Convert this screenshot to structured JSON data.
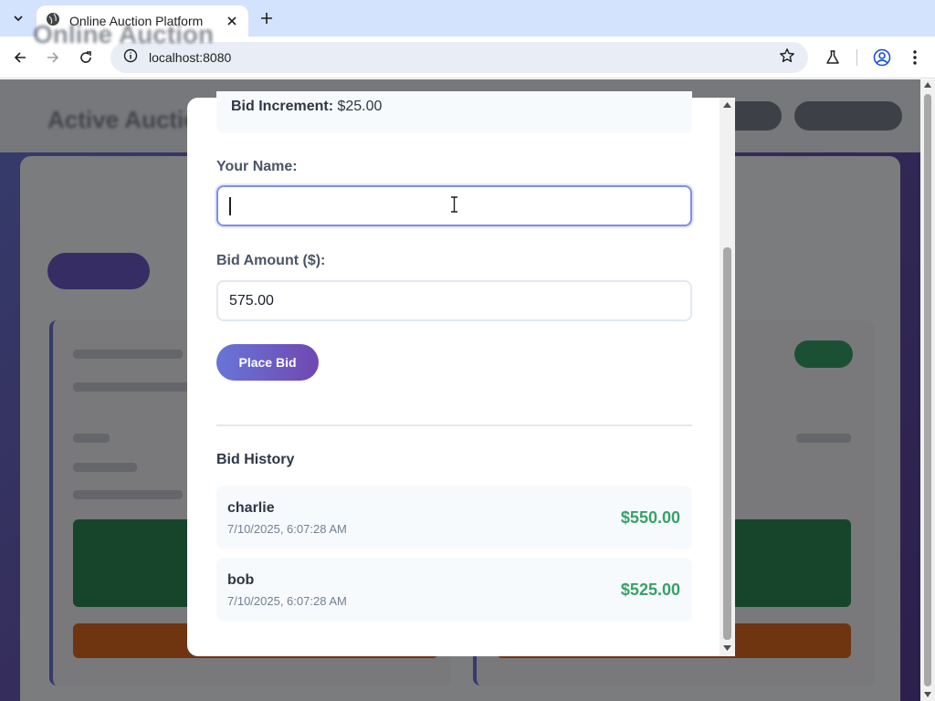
{
  "browser": {
    "tab_title": "Online Auction Platform",
    "url": "localhost:8080"
  },
  "background": {
    "app_title": "Online Auction",
    "section_title": "Active Auctions"
  },
  "modal": {
    "increment_label": "Bid Increment:",
    "increment_value": "$25.00",
    "name_label": "Your Name:",
    "name_value": "",
    "amount_label": "Bid Amount ($):",
    "amount_value": "575.00",
    "place_bid_label": "Place Bid",
    "history_title": "Bid History",
    "bids": [
      {
        "bidder": "charlie",
        "time": "7/10/2025, 6:07:28 AM",
        "amount": "$550.00"
      },
      {
        "bidder": "bob",
        "time": "7/10/2025, 6:07:28 AM",
        "amount": "$525.00"
      }
    ]
  },
  "colors": {
    "accent_purple": "#6875d8",
    "bid_green": "#38a169",
    "focus_border": "#7f8ee6"
  },
  "icons": [
    "chevron-down-icon",
    "globe-icon",
    "close-icon",
    "plus-icon",
    "back-icon",
    "forward-icon",
    "reload-icon",
    "info-icon",
    "star-icon",
    "labs-icon",
    "profile-icon",
    "menu-icon"
  ]
}
